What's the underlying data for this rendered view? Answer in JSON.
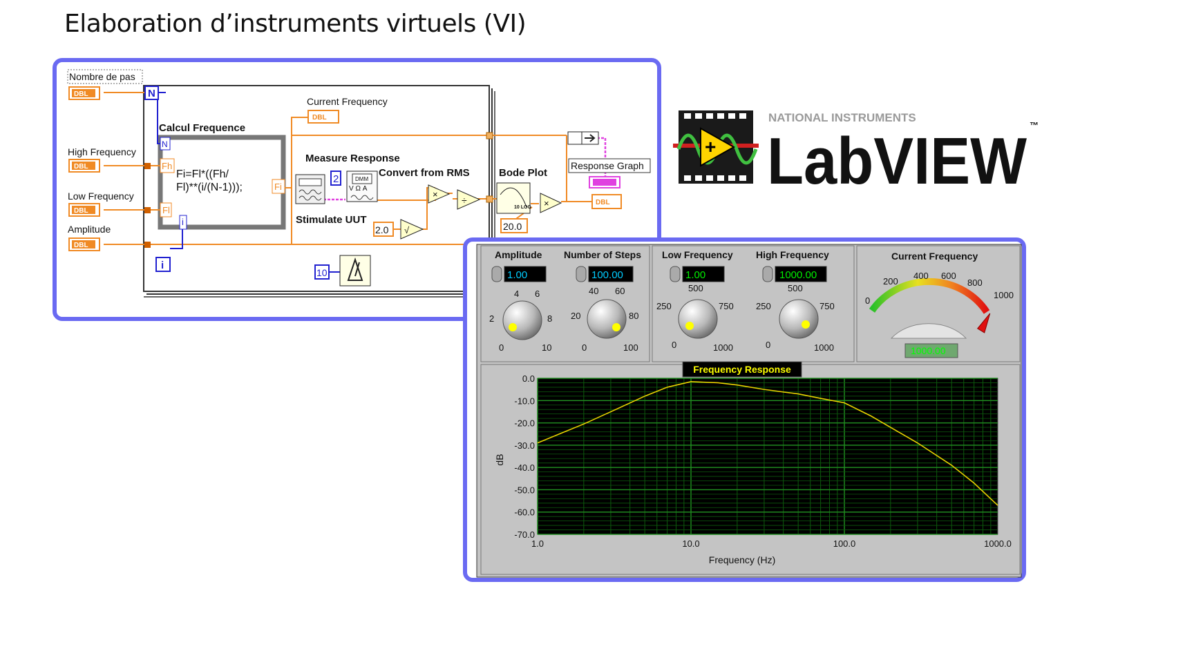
{
  "slide": {
    "title": "Elaboration d’instruments virtuels (VI)"
  },
  "logo": {
    "company": "NATIONAL INSTRUMENTS",
    "product": "LabVIEW",
    "tm": "™"
  },
  "block_diagram": {
    "nombre_de_pas": "Nombre de pas",
    "high_frequency": "High Frequency",
    "low_frequency": "Low Frequency",
    "amplitude": "Amplitude",
    "current_frequency": "Current Frequency",
    "dbl": "DBL",
    "loop_count": "N",
    "loop_iteration": "i",
    "calcul_frequence": "Calcul Frequence",
    "formula_line1": "Fi=Fl*((Fh/",
    "formula_line2": "Fl)**(i/(N-1)));",
    "node_n": "N",
    "node_fh": "Fh",
    "node_fl": "Fl",
    "node_i": "i",
    "node_fi": "Fi",
    "measure_response": "Measure Response",
    "dmm_label": "DMM",
    "dmm_mode": "V Ω A",
    "const_2": "2",
    "convert_from_rms": "Convert from RMS",
    "stimulate_uut": "Stimulate UUT",
    "const_2_0": "2.0",
    "sqrt_symbol": "√",
    "multiply_symbol": "×",
    "divide_symbol": "÷",
    "bode_plot": "Bode Plot",
    "bode_icon_text": "10 LOG",
    "const_20_0": "20.0",
    "response_graph": "Response Graph",
    "const_10": "10"
  },
  "front_panel": {
    "amplitude": {
      "label": "Amplitude",
      "value": "1.00",
      "ticks": [
        "0",
        "2",
        "4",
        "6",
        "8",
        "10"
      ]
    },
    "steps": {
      "label": "Number of Steps",
      "value": "100.00",
      "ticks": [
        "0",
        "20",
        "40",
        "60",
        "80",
        "100"
      ]
    },
    "low_freq": {
      "label": "Low Frequency",
      "value": "1.00",
      "ticks": [
        "0",
        "250",
        "500",
        "750",
        "1000"
      ]
    },
    "high_freq": {
      "label": "High Frequency",
      "value": "1000.00",
      "ticks": [
        "0",
        "250",
        "500",
        "750",
        "1000"
      ]
    },
    "current_freq": {
      "label": "Current Frequency",
      "value": "1000.00",
      "ticks": [
        "0",
        "200",
        "400",
        "600",
        "800",
        "1000"
      ],
      "level": 1000
    }
  },
  "chart_data": {
    "type": "line",
    "title": "Frequency Response",
    "xlabel": "Frequency (Hz)",
    "ylabel": "dB",
    "xscale": "log",
    "xlim": [
      1,
      1000
    ],
    "ylim": [
      -70,
      0
    ],
    "x_ticks": [
      "1.0",
      "10.0",
      "100.0",
      "1000.0"
    ],
    "y_ticks": [
      "0.0",
      "-10.0",
      "-20.0",
      "-30.0",
      "-40.0",
      "-50.0",
      "-60.0",
      "-70.0"
    ],
    "grid": true,
    "series": [
      {
        "x": [
          1,
          1.5,
          2,
          3,
          5,
          7,
          10,
          15,
          20,
          30,
          50,
          70,
          100,
          150,
          200,
          300,
          500,
          700,
          1000
        ],
        "y": [
          -29,
          -24,
          -20.5,
          -15,
          -8,
          -4,
          -1.5,
          -2,
          -3,
          -5,
          -7,
          -9,
          -11,
          -17,
          -22,
          -29,
          -39,
          -47,
          -57
        ]
      }
    ],
    "colors": {
      "line": "#e8d000",
      "plot_bg": "#000000",
      "grid": "#0d5a0d"
    }
  }
}
